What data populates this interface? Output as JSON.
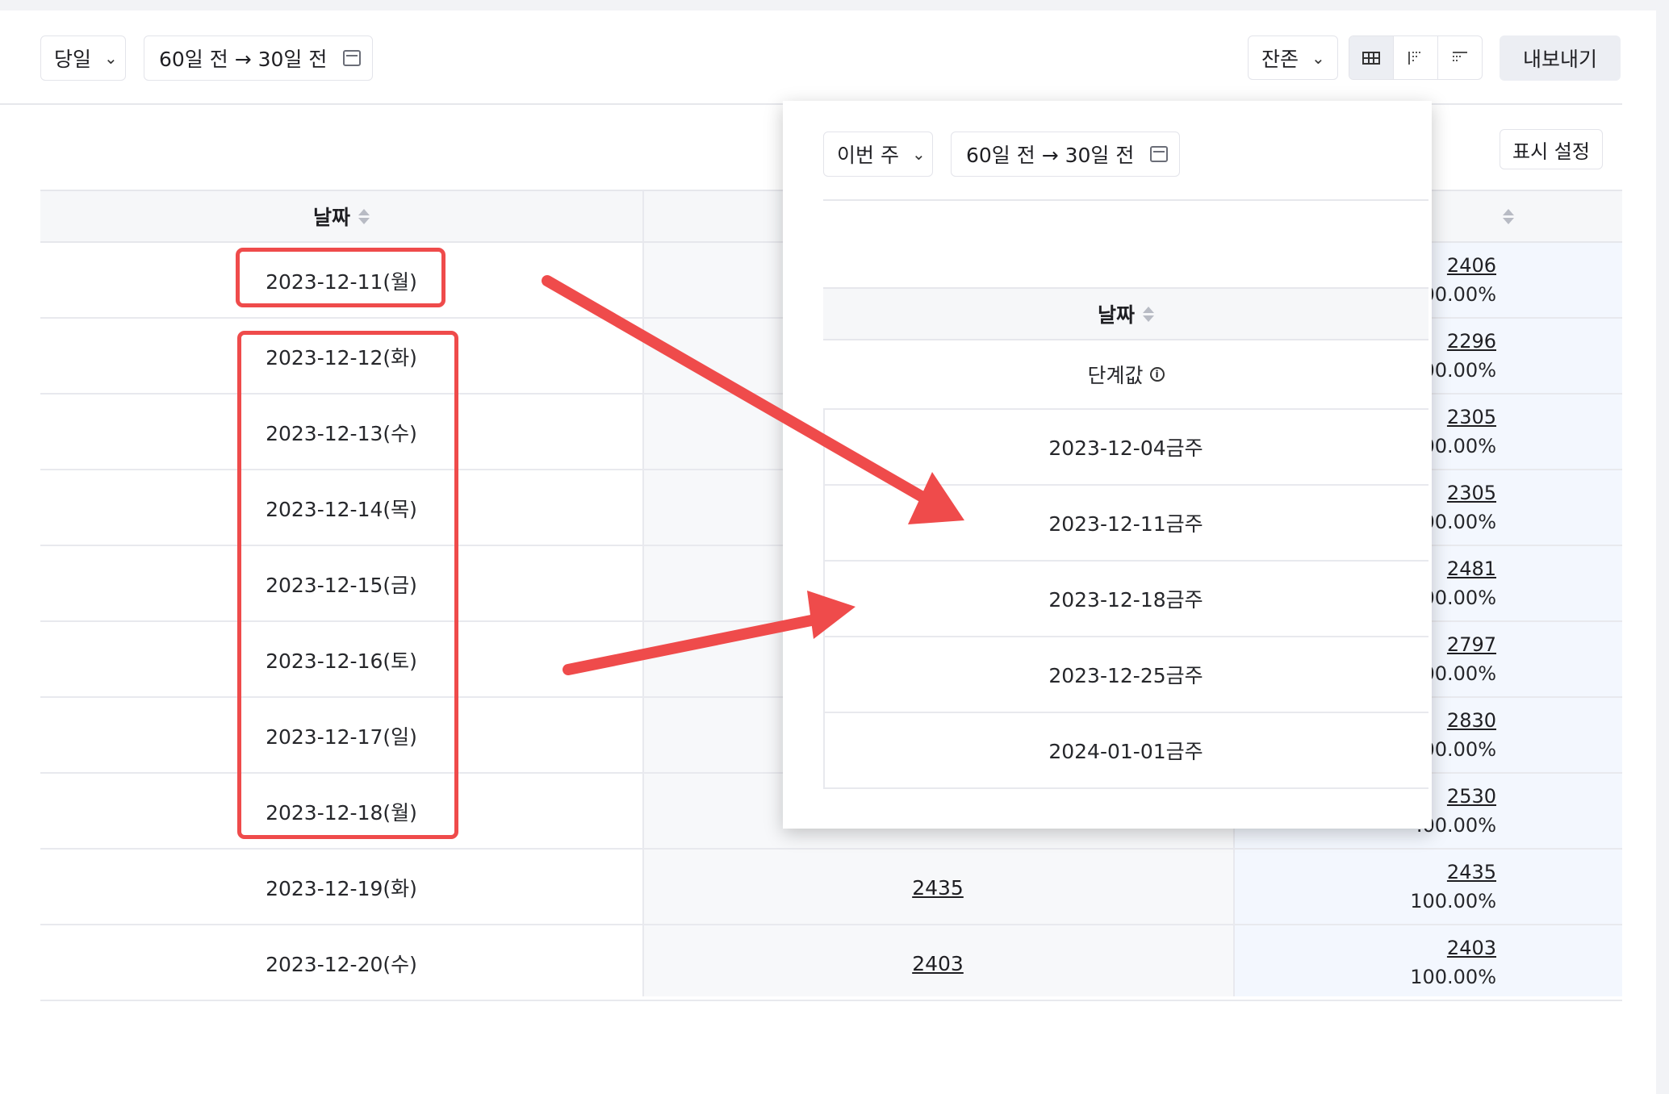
{
  "toolbar": {
    "period_select": "당일",
    "date_range": "60일 전 → 30일 전",
    "metric_select": "잔존",
    "export_label": "내보내기",
    "view_modes": [
      "grid-view-icon",
      "bar-view-icon",
      "list-view-icon"
    ]
  },
  "display_settings_label": "표시 설정",
  "table": {
    "date_header": "날짜",
    "rows": [
      {
        "date": "2023-12-11(월)",
        "mid": "",
        "right_value": "2406",
        "right_pct": "00.00%"
      },
      {
        "date": "2023-12-12(화)",
        "mid": "",
        "right_value": "2296",
        "right_pct": "00.00%"
      },
      {
        "date": "2023-12-13(수)",
        "mid": "",
        "right_value": "2305",
        "right_pct": "00.00%"
      },
      {
        "date": "2023-12-14(목)",
        "mid": "",
        "right_value": "2305",
        "right_pct": "00.00%"
      },
      {
        "date": "2023-12-15(금)",
        "mid": "",
        "right_value": "2481",
        "right_pct": "00.00%"
      },
      {
        "date": "2023-12-16(토)",
        "mid": "",
        "right_value": "2797",
        "right_pct": "00.00%"
      },
      {
        "date": "2023-12-17(일)",
        "mid": "",
        "right_value": "2830",
        "right_pct": "00.00%"
      },
      {
        "date": "2023-12-18(월)",
        "mid": "",
        "right_value": "2530",
        "right_pct": ".00.00%"
      },
      {
        "date": "2023-12-19(화)",
        "mid": "2435",
        "right_value": "2435",
        "right_pct": "100.00%"
      },
      {
        "date": "2023-12-20(수)",
        "mid": "2403",
        "right_value": "2403",
        "right_pct": "100.00%"
      }
    ]
  },
  "popup": {
    "period_select": "이번 주",
    "date_range": "60일 전 → 30일 전",
    "date_header": "날짜",
    "step_label": "단계값",
    "weeks": [
      "2023-12-04금주",
      "2023-12-11금주",
      "2023-12-18금주",
      "2023-12-25금주",
      "2024-01-01금주"
    ]
  },
  "colors": {
    "annotation_red": "#ef4b4b",
    "header_bg": "#f6f7f9",
    "right_col_bg": "#f3f7fe",
    "export_bg": "#eceef3"
  }
}
